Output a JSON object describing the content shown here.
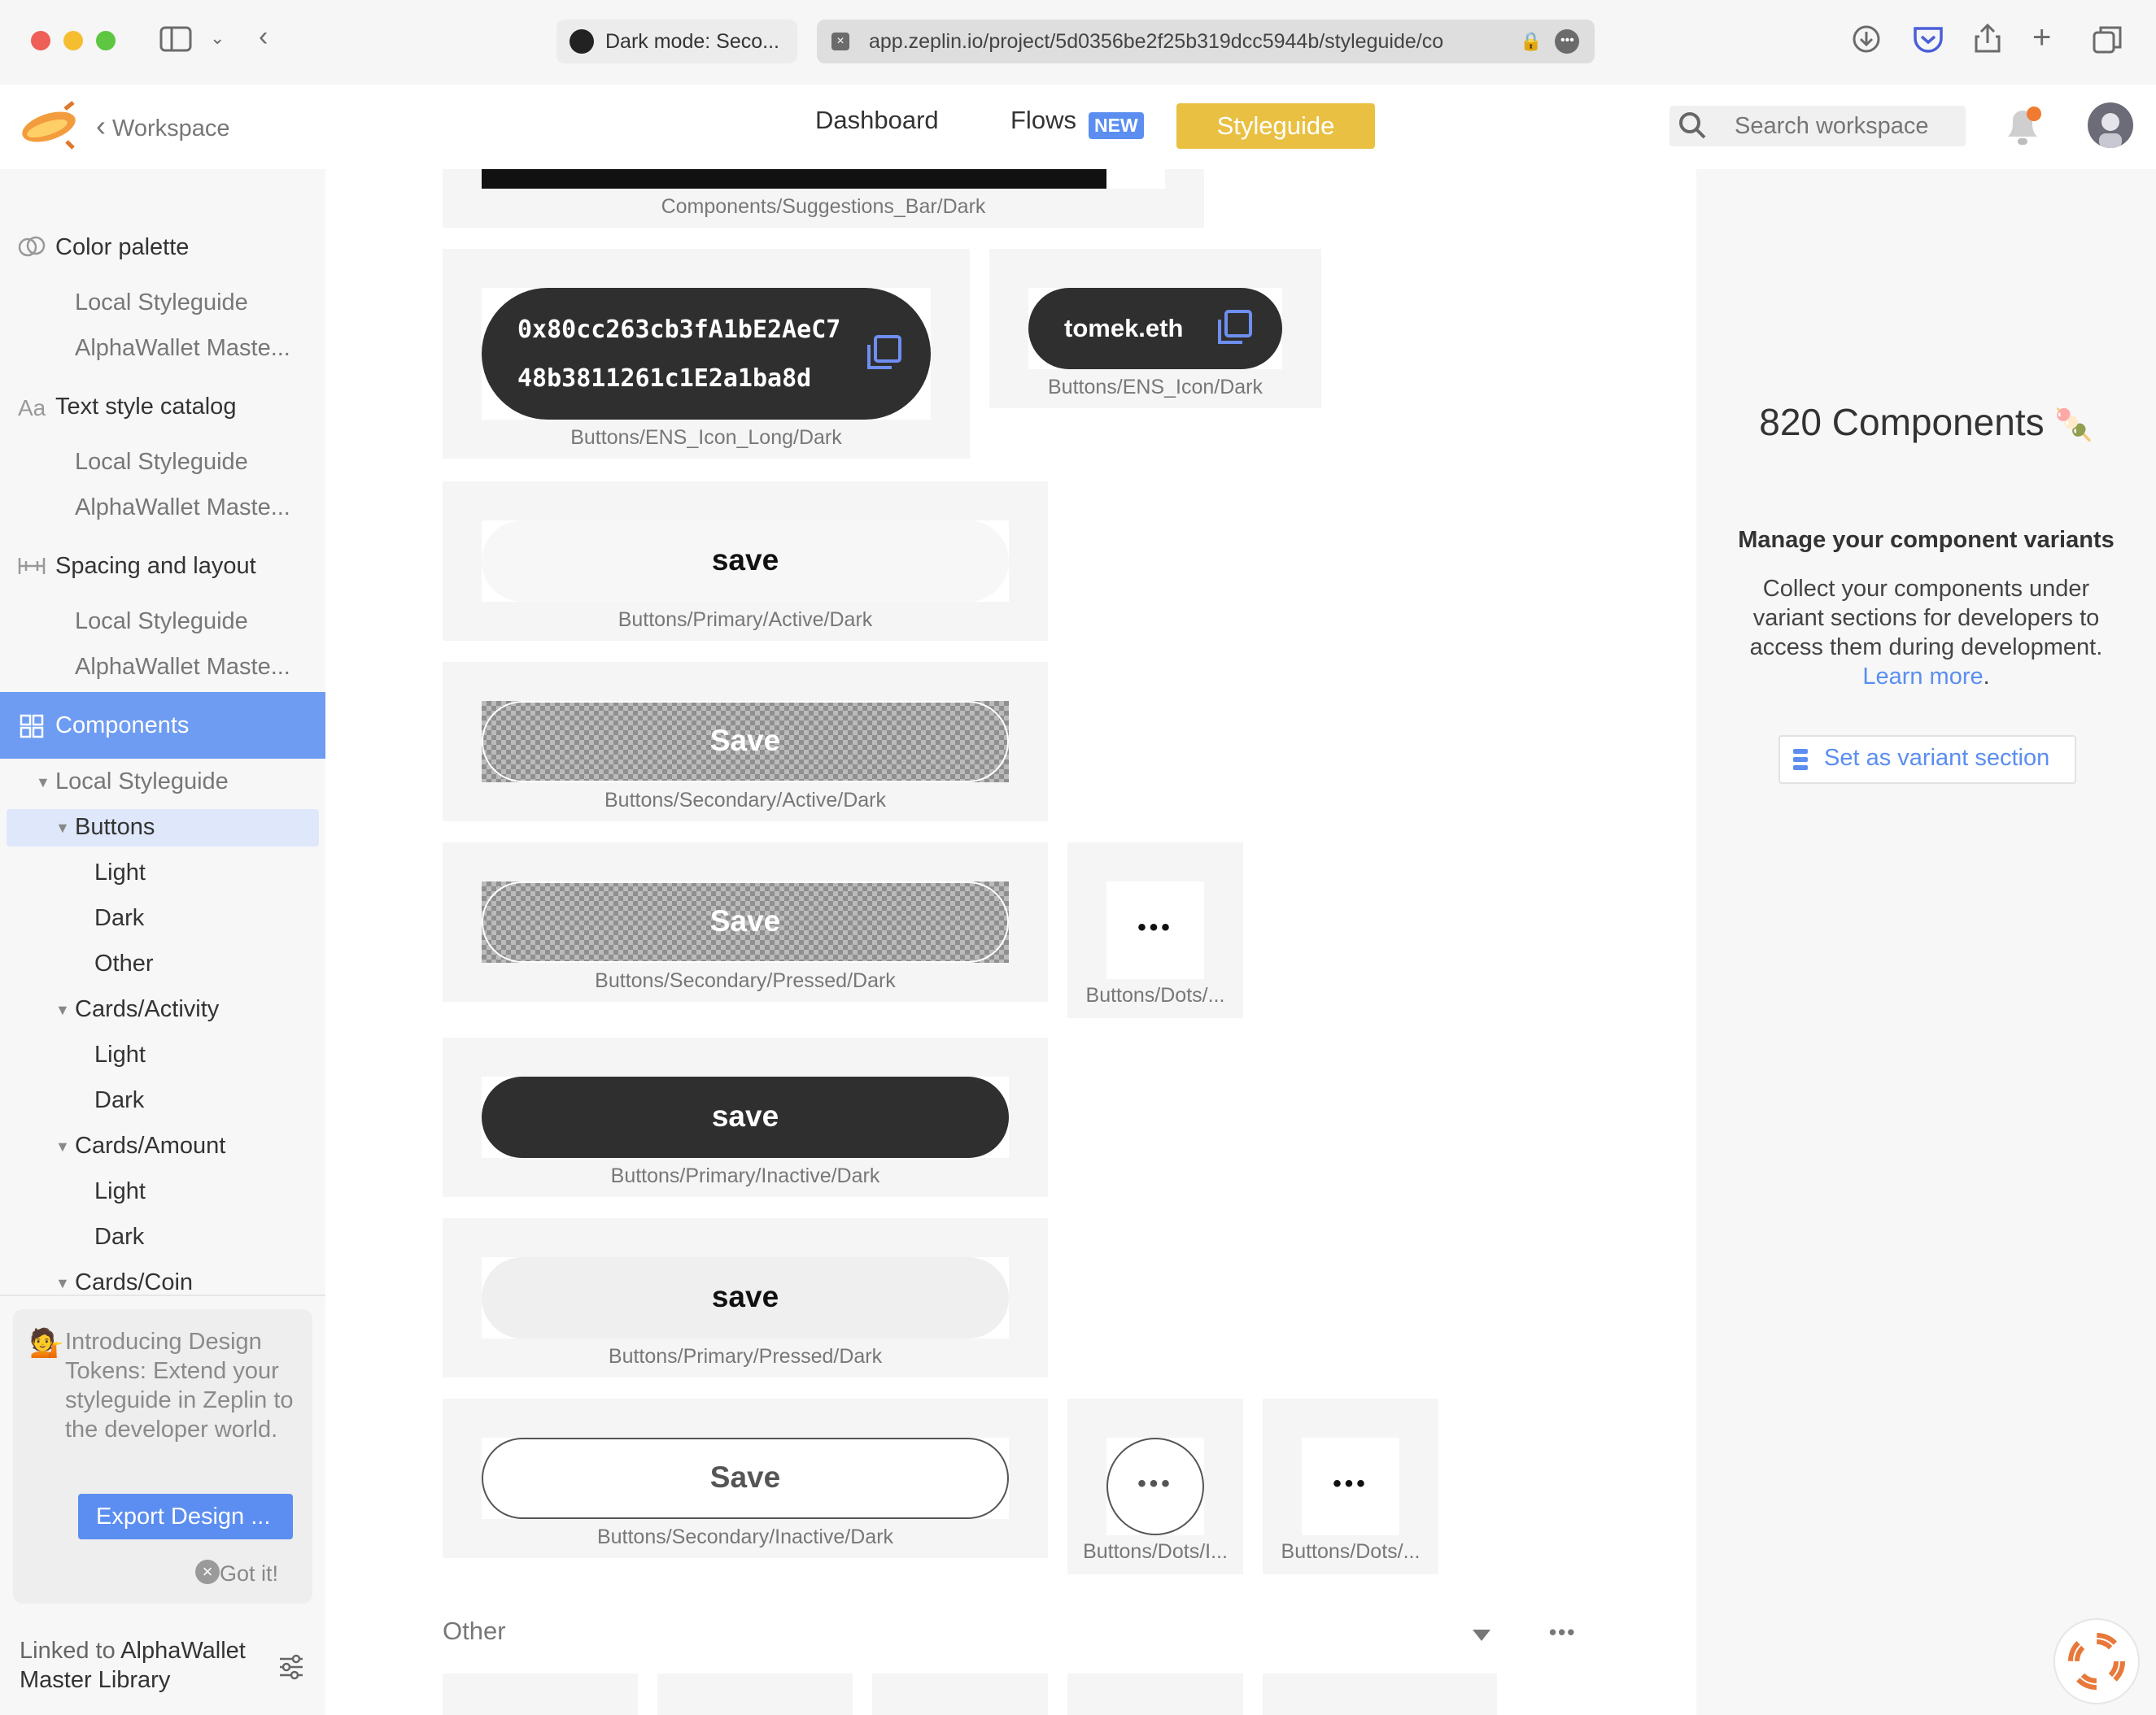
{
  "browser": {
    "tab_inactive_title": "Dark mode: Seco...",
    "url": "app.zeplin.io/project/5d0356be2f25b319dcc5944b/styleguide/co"
  },
  "header": {
    "back_label": "Workspace",
    "nav_dashboard": "Dashboard",
    "nav_flows": "Flows",
    "nav_flows_badge": "NEW",
    "nav_styleguide": "Styleguide",
    "search_placeholder": "Search workspace"
  },
  "sidebar": {
    "color_palette": "Color palette",
    "text_style_catalog": "Text style catalog",
    "spacing_layout": "Spacing and layout",
    "local_styleguide": "Local Styleguide",
    "alpha_master": "AlphaWallet Maste...",
    "components": "Components",
    "tree": {
      "local_styleguide": "Local Styleguide",
      "buttons": "Buttons",
      "light": "Light",
      "dark": "Dark",
      "other": "Other",
      "cards_activity": "Cards/Activity",
      "cards_amount": "Cards/Amount",
      "cards_coin": "Cards/Coin"
    },
    "promo": {
      "emoji": "💁",
      "text": "Introducing Design Tokens: Extend your styleguide in Zeplin to the developer world.",
      "button": "Export Design ...",
      "dismiss": "Got it!"
    },
    "linked_prefix": "Linked to ",
    "linked_library": "AlphaWallet Master Library"
  },
  "canvas": {
    "suggestions_label": "Components/Suggestions_Bar/Dark",
    "ens_long_line1": "0x80cc263cb3fA1bE2AeC7",
    "ens_long_line2": "48b3811261c1E2a1ba8d",
    "ens_long_label": "Buttons/ENS_Icon_Long/Dark",
    "ens_short_text": "tomek.eth",
    "ens_short_label": "Buttons/ENS_Icon/Dark",
    "primary_active_text": "save",
    "primary_active_label": "Buttons/Primary/Active/Dark",
    "secondary_active_text": "Save",
    "secondary_active_label": "Buttons/Secondary/Active/Dark",
    "secondary_pressed_text": "Save",
    "secondary_pressed_label": "Buttons/Secondary/Pressed/Dark",
    "dots_label_1": "Buttons/Dots/...",
    "dots_glyph": "•••",
    "primary_inactive_text": "save",
    "primary_inactive_label": "Buttons/Primary/Inactive/Dark",
    "primary_pressed_text": "save",
    "primary_pressed_label": "Buttons/Primary/Pressed/Dark",
    "secondary_inactive_text": "Save",
    "secondary_inactive_label": "Buttons/Secondary/Inactive/Dark",
    "dots_label_2": "Buttons/Dots/I...",
    "dots_label_3": "Buttons/Dots/...",
    "section_other": "Other"
  },
  "right_panel": {
    "count_title": "820 Components",
    "count_emoji": "🍡",
    "heading": "Manage your component variants",
    "body": "Collect your components under variant sections for developers to access them during development.",
    "learn_more": "Learn more",
    "period": ".",
    "variant_button": "Set as variant section"
  },
  "colors": {
    "accent_blue": "#5b8ef0",
    "styleguide_yellow": "#eac042",
    "dark_pill": "#2f2f2f"
  }
}
